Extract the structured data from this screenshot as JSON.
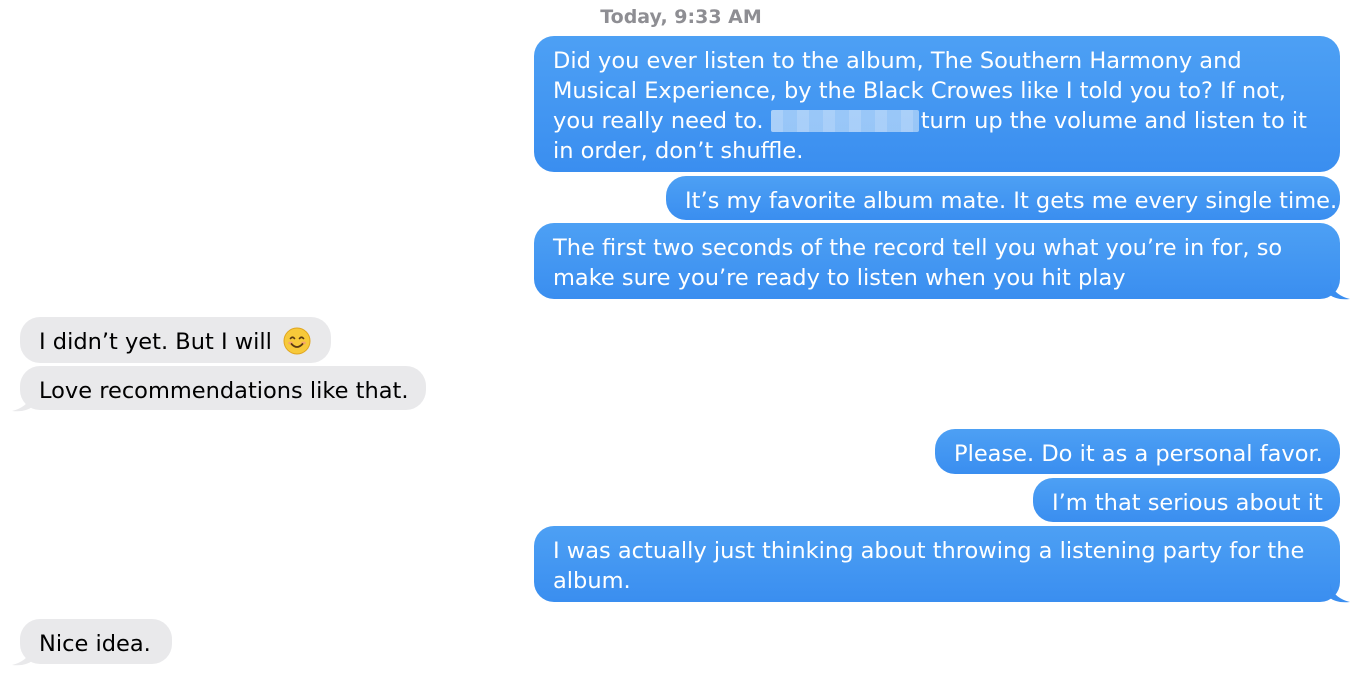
{
  "conversation": {
    "timestamp": "Today, 9:33 AM",
    "colors": {
      "sent_bubble": "#3a8ef0",
      "received_bubble": "#e9e9eb",
      "timestamp_text": "#8e8e93"
    },
    "messages": [
      {
        "direction": "sent",
        "lines": [
          "Did you ever listen to the album, The Southern Harmony and",
          "Musical Experience, by the Black Crowes like I told you to? If not,",
          "you really need to.",
          "turn up the volume and listen to it",
          "in order, don’t shuffle."
        ],
        "redacted": true
      },
      {
        "direction": "sent",
        "text": "It’s my favorite album mate. It gets me every single time."
      },
      {
        "direction": "sent",
        "lines": [
          "The first two seconds of the record tell you what you’re in for, so",
          "make sure you’re ready to listen when you hit play"
        ]
      },
      {
        "direction": "received",
        "text": "I didn’t yet. But I will",
        "emoji": "smiling-face-icon"
      },
      {
        "direction": "received",
        "text": "Love recommendations like that."
      },
      {
        "direction": "sent",
        "text": "Please. Do it as a personal favor."
      },
      {
        "direction": "sent",
        "text": "I’m that serious about it"
      },
      {
        "direction": "sent",
        "lines": [
          "I was actually just thinking about throwing a listening party for the",
          "album."
        ]
      },
      {
        "direction": "received",
        "text": "Nice idea."
      }
    ]
  }
}
